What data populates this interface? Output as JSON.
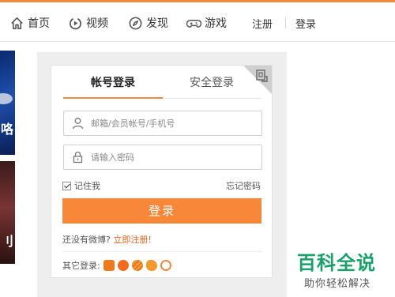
{
  "nav": {
    "home": "首页",
    "video": "视频",
    "discover": "发现",
    "game": "游戏",
    "register": "注册",
    "login": "登录"
  },
  "thumbs": {
    "first_char": "咯",
    "second_char": "刂"
  },
  "login_card": {
    "tab_account": "帐号登录",
    "tab_secure": "安全登录",
    "username_placeholder": "邮箱/会员帐号/手机号",
    "password_placeholder": "请输入密码",
    "remember_label": "记住我",
    "remember_checked": true,
    "forgot_label": "忘记密码",
    "login_button": "登录",
    "signup_prompt": "还没有微博?",
    "signup_link": "立即注册!",
    "other_login_label": "其它登录:",
    "social_icons": [
      "weibo-icon",
      "qq-icon",
      "baidu-icon",
      "tianyi-icon",
      "360-icon"
    ]
  },
  "watermark": {
    "title": "百科全说",
    "subtitle": "助你轻松解决"
  },
  "colors": {
    "accent": "#f8873a",
    "link": "#e8641a",
    "watermark": "#1aa06b"
  }
}
